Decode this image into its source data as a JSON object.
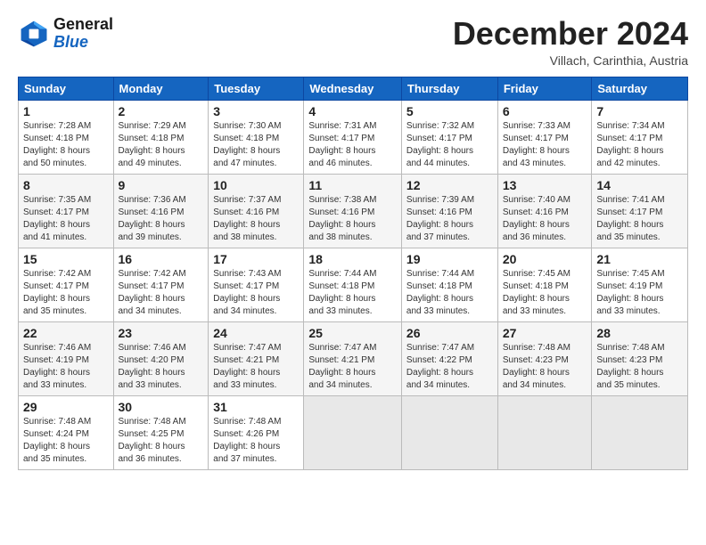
{
  "header": {
    "logo_line1": "General",
    "logo_line2": "Blue",
    "month": "December 2024",
    "location": "Villach, Carinthia, Austria"
  },
  "weekdays": [
    "Sunday",
    "Monday",
    "Tuesday",
    "Wednesday",
    "Thursday",
    "Friday",
    "Saturday"
  ],
  "weeks": [
    [
      {
        "day": "1",
        "info": "Sunrise: 7:28 AM\nSunset: 4:18 PM\nDaylight: 8 hours\nand 50 minutes."
      },
      {
        "day": "2",
        "info": "Sunrise: 7:29 AM\nSunset: 4:18 PM\nDaylight: 8 hours\nand 49 minutes."
      },
      {
        "day": "3",
        "info": "Sunrise: 7:30 AM\nSunset: 4:18 PM\nDaylight: 8 hours\nand 47 minutes."
      },
      {
        "day": "4",
        "info": "Sunrise: 7:31 AM\nSunset: 4:17 PM\nDaylight: 8 hours\nand 46 minutes."
      },
      {
        "day": "5",
        "info": "Sunrise: 7:32 AM\nSunset: 4:17 PM\nDaylight: 8 hours\nand 44 minutes."
      },
      {
        "day": "6",
        "info": "Sunrise: 7:33 AM\nSunset: 4:17 PM\nDaylight: 8 hours\nand 43 minutes."
      },
      {
        "day": "7",
        "info": "Sunrise: 7:34 AM\nSunset: 4:17 PM\nDaylight: 8 hours\nand 42 minutes."
      }
    ],
    [
      {
        "day": "8",
        "info": "Sunrise: 7:35 AM\nSunset: 4:17 PM\nDaylight: 8 hours\nand 41 minutes."
      },
      {
        "day": "9",
        "info": "Sunrise: 7:36 AM\nSunset: 4:16 PM\nDaylight: 8 hours\nand 39 minutes."
      },
      {
        "day": "10",
        "info": "Sunrise: 7:37 AM\nSunset: 4:16 PM\nDaylight: 8 hours\nand 38 minutes."
      },
      {
        "day": "11",
        "info": "Sunrise: 7:38 AM\nSunset: 4:16 PM\nDaylight: 8 hours\nand 38 minutes."
      },
      {
        "day": "12",
        "info": "Sunrise: 7:39 AM\nSunset: 4:16 PM\nDaylight: 8 hours\nand 37 minutes."
      },
      {
        "day": "13",
        "info": "Sunrise: 7:40 AM\nSunset: 4:16 PM\nDaylight: 8 hours\nand 36 minutes."
      },
      {
        "day": "14",
        "info": "Sunrise: 7:41 AM\nSunset: 4:17 PM\nDaylight: 8 hours\nand 35 minutes."
      }
    ],
    [
      {
        "day": "15",
        "info": "Sunrise: 7:42 AM\nSunset: 4:17 PM\nDaylight: 8 hours\nand 35 minutes."
      },
      {
        "day": "16",
        "info": "Sunrise: 7:42 AM\nSunset: 4:17 PM\nDaylight: 8 hours\nand 34 minutes."
      },
      {
        "day": "17",
        "info": "Sunrise: 7:43 AM\nSunset: 4:17 PM\nDaylight: 8 hours\nand 34 minutes."
      },
      {
        "day": "18",
        "info": "Sunrise: 7:44 AM\nSunset: 4:18 PM\nDaylight: 8 hours\nand 33 minutes."
      },
      {
        "day": "19",
        "info": "Sunrise: 7:44 AM\nSunset: 4:18 PM\nDaylight: 8 hours\nand 33 minutes."
      },
      {
        "day": "20",
        "info": "Sunrise: 7:45 AM\nSunset: 4:18 PM\nDaylight: 8 hours\nand 33 minutes."
      },
      {
        "day": "21",
        "info": "Sunrise: 7:45 AM\nSunset: 4:19 PM\nDaylight: 8 hours\nand 33 minutes."
      }
    ],
    [
      {
        "day": "22",
        "info": "Sunrise: 7:46 AM\nSunset: 4:19 PM\nDaylight: 8 hours\nand 33 minutes."
      },
      {
        "day": "23",
        "info": "Sunrise: 7:46 AM\nSunset: 4:20 PM\nDaylight: 8 hours\nand 33 minutes."
      },
      {
        "day": "24",
        "info": "Sunrise: 7:47 AM\nSunset: 4:21 PM\nDaylight: 8 hours\nand 33 minutes."
      },
      {
        "day": "25",
        "info": "Sunrise: 7:47 AM\nSunset: 4:21 PM\nDaylight: 8 hours\nand 34 minutes."
      },
      {
        "day": "26",
        "info": "Sunrise: 7:47 AM\nSunset: 4:22 PM\nDaylight: 8 hours\nand 34 minutes."
      },
      {
        "day": "27",
        "info": "Sunrise: 7:48 AM\nSunset: 4:23 PM\nDaylight: 8 hours\nand 34 minutes."
      },
      {
        "day": "28",
        "info": "Sunrise: 7:48 AM\nSunset: 4:23 PM\nDaylight: 8 hours\nand 35 minutes."
      }
    ],
    [
      {
        "day": "29",
        "info": "Sunrise: 7:48 AM\nSunset: 4:24 PM\nDaylight: 8 hours\nand 35 minutes."
      },
      {
        "day": "30",
        "info": "Sunrise: 7:48 AM\nSunset: 4:25 PM\nDaylight: 8 hours\nand 36 minutes."
      },
      {
        "day": "31",
        "info": "Sunrise: 7:48 AM\nSunset: 4:26 PM\nDaylight: 8 hours\nand 37 minutes."
      },
      null,
      null,
      null,
      null
    ]
  ]
}
